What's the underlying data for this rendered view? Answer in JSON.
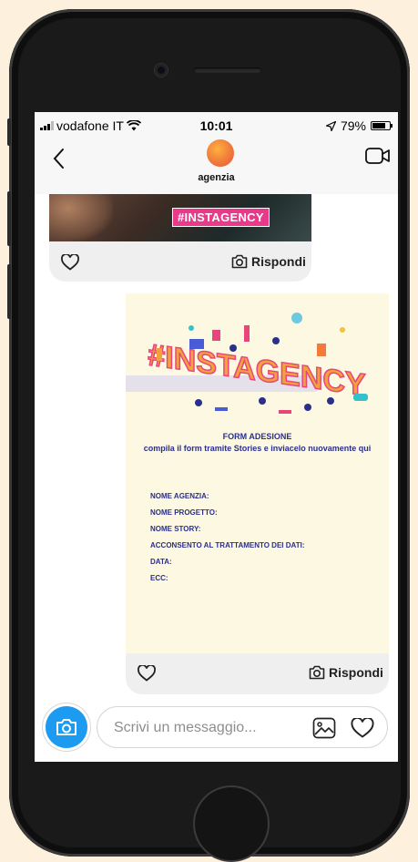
{
  "statusbar": {
    "carrier": "vodafone IT",
    "time": "10:01",
    "battery": "79%",
    "battery_level": 0.79
  },
  "header": {
    "title": "agenzia"
  },
  "top_message": {
    "hashtag": "#INSTAGENCY",
    "reply_label": "Rispondi"
  },
  "main_message": {
    "art_text": "#INSTAGENCY",
    "form_title": "FORM ADESIONE",
    "form_subtitle": "compila il form tramite Stories e inviacelo nuovamente qui",
    "fields": [
      "NOME AGENZIA:",
      "NOME PROGETTO:",
      "NOME STORY:",
      "ACCONSENTO AL TRATTAMENTO DEI DATI:",
      "DATA:",
      "ECC:"
    ],
    "reply_label": "Rispondi"
  },
  "composer": {
    "placeholder": "Scrivi un messaggio..."
  },
  "icons": {
    "back": "chevron-left-icon",
    "video": "video-camera-icon",
    "heart": "heart-icon",
    "reply": "camera-icon",
    "gallery": "image-icon"
  },
  "colors": {
    "accent": "#1d9bf0",
    "tag": "#e8398a",
    "form_text": "#2a2f8c",
    "doc_bg": "#fcf8e2"
  }
}
